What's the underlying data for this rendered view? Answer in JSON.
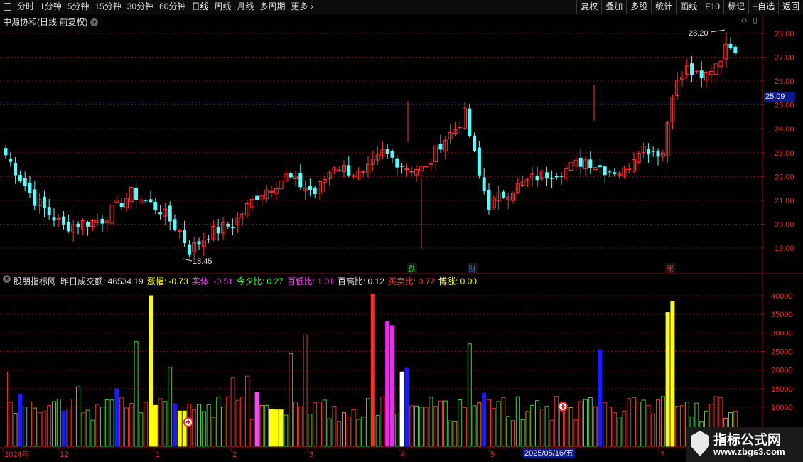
{
  "toolbar": {
    "periods": [
      "分时",
      "1分钟",
      "5分钟",
      "15分钟",
      "30分钟",
      "60分钟",
      "日线",
      "周线",
      "月线",
      "多周期",
      "更多"
    ],
    "active_period": "日线",
    "right_buttons": [
      "复权",
      "叠加",
      "多股",
      "统计",
      "画线",
      "F10",
      "标记",
      "+自选",
      "返回"
    ]
  },
  "main": {
    "title": "中源协和(日线 前复权)",
    "price_axis": [
      "28.00",
      "27.00",
      "26.00",
      "25.00",
      "24.00",
      "23.00",
      "22.00",
      "21.00",
      "20.00",
      "19.00"
    ],
    "current_price": "25.09",
    "high_label": "28.20",
    "low_label": "18.45",
    "markers": [
      {
        "text": "跌",
        "color": "#22cc22"
      },
      {
        "text": "财",
        "color": "#2a6cff"
      },
      {
        "text": "涨",
        "color": "#ff3030"
      }
    ]
  },
  "indicator": {
    "name": "股朋指标网",
    "fields": [
      {
        "label": "昨日成交额:",
        "value": "46534.19",
        "color": "#e0e0e0"
      },
      {
        "label": "涨幅:",
        "value": "-0.73",
        "color": "#ffff00"
      },
      {
        "label": "实体:",
        "value": "-0.51",
        "color": "#ff40ff"
      },
      {
        "label": "今夕比:",
        "value": "0.27",
        "color": "#40ff40"
      },
      {
        "label": "百低比:",
        "value": "1.01",
        "color": "#ff40ff"
      },
      {
        "label": "百高比:",
        "value": "0.12",
        "color": "#e0e0e0"
      },
      {
        "label": "买卖比:",
        "value": "0.72",
        "color": "#ff4040"
      },
      {
        "label": "博涨:",
        "value": "0.00",
        "color": "#ffff60"
      }
    ],
    "axis": [
      "40000",
      "35000",
      "30000",
      "25000",
      "20000",
      "15000",
      "10000"
    ]
  },
  "time_axis": [
    "2024年",
    "12",
    "1",
    "2",
    "3",
    "4",
    "5",
    "2025/05/16/五",
    "7"
  ],
  "watermark": {
    "title": "指标公式网",
    "url": "www.zbgs3.com"
  },
  "colors": {
    "up": "#ff3232",
    "down": "#54ffff",
    "grid": "#7a1010"
  }
}
